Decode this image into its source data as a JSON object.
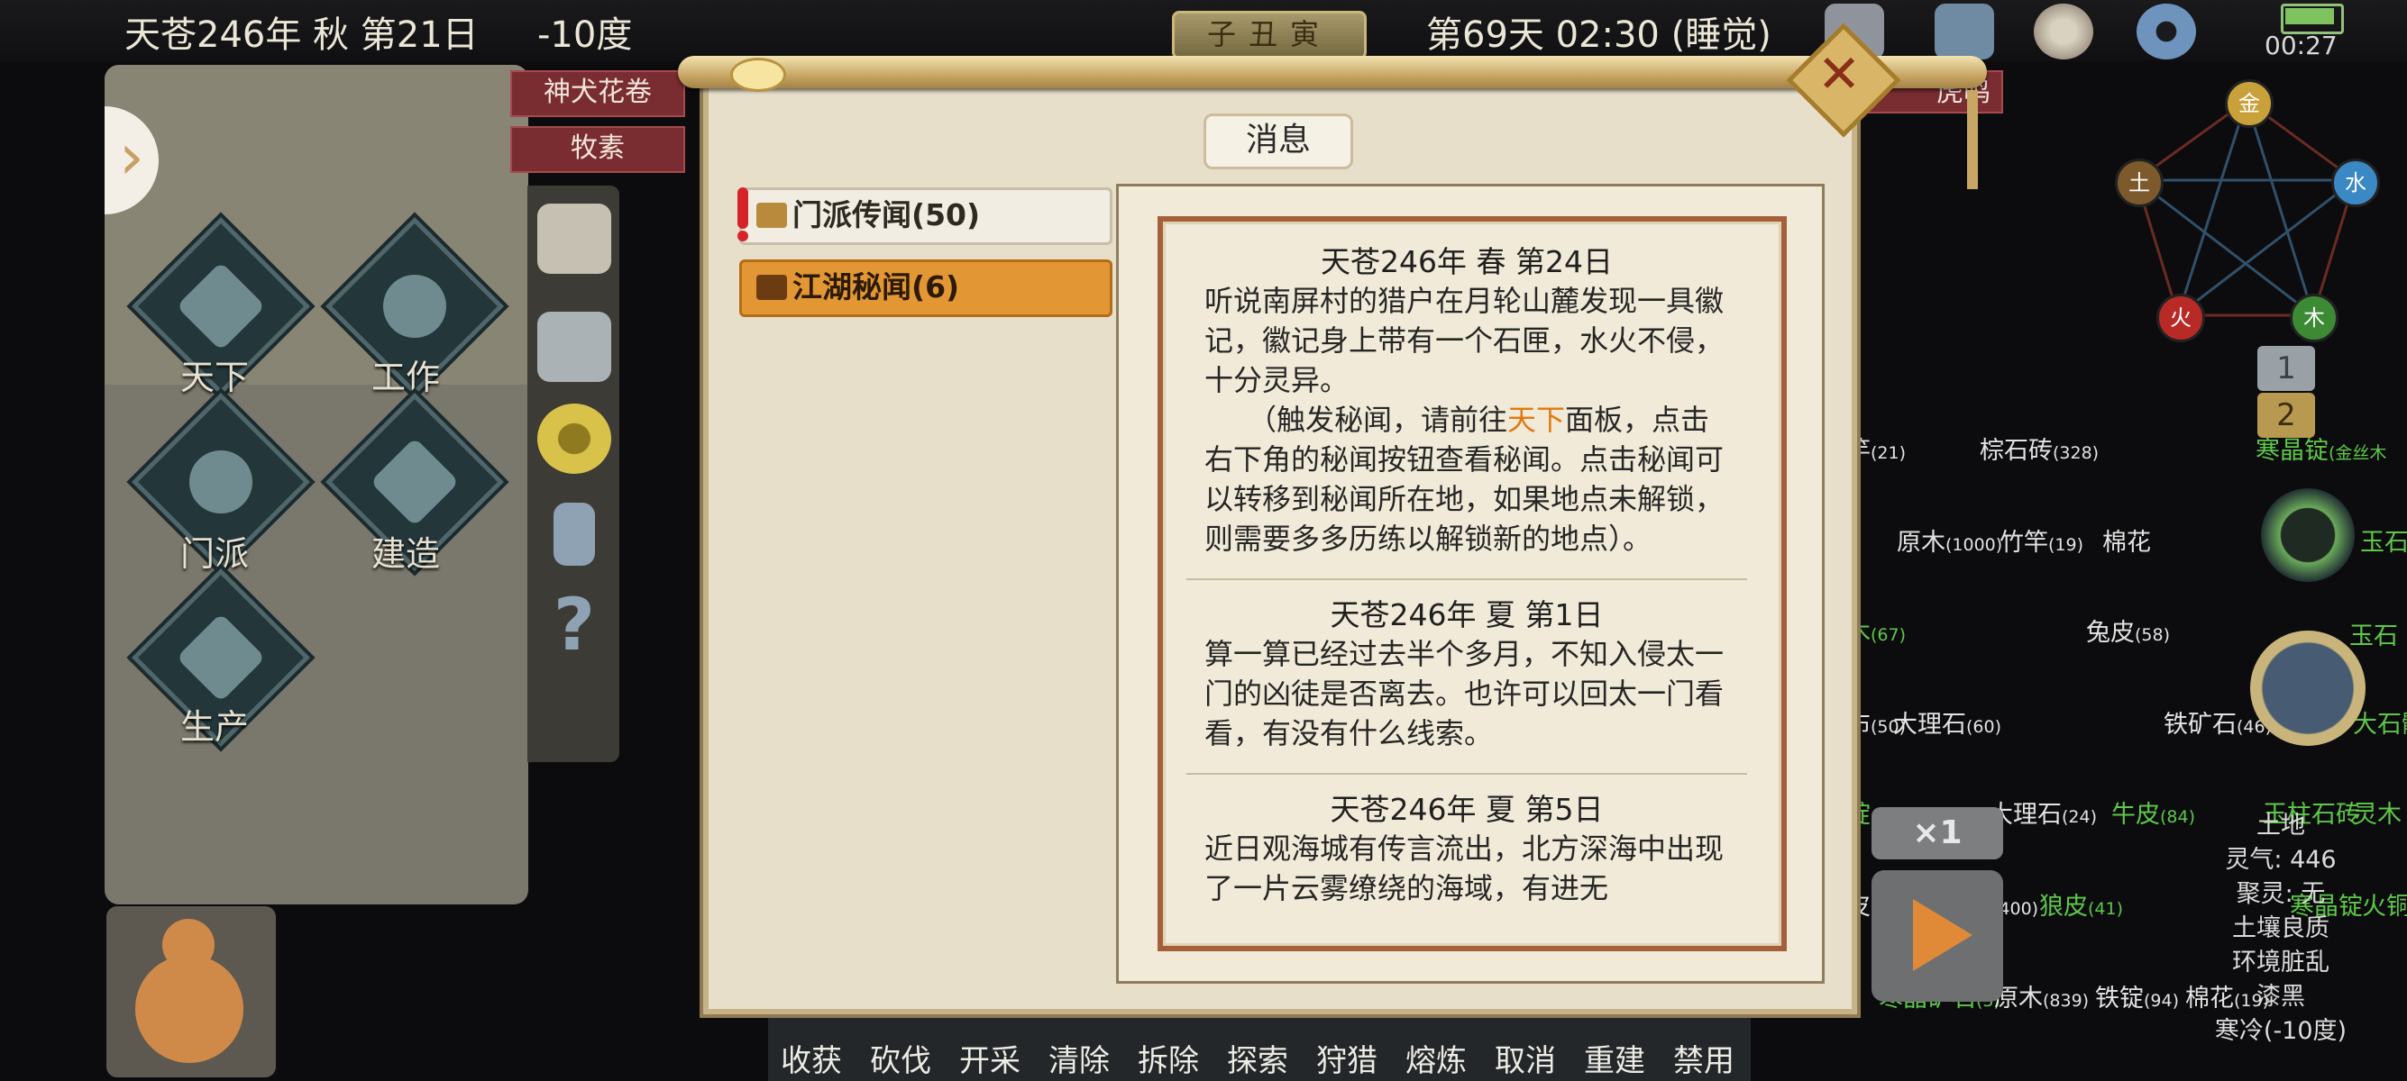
{
  "topbar": {
    "date": "天苍246年 秋 第21日",
    "temperature": "-10度",
    "zodiac": "子丑寅",
    "day_time": "第69天 02:30 (睡觉)",
    "clock": "00:27",
    "colors": {
      "bar": "#101012",
      "zodiac": "#a99a6c"
    }
  },
  "left_menu": {
    "items": [
      {
        "label": "天下",
        "icon": "world-map-icon"
      },
      {
        "label": "工作",
        "icon": "clock-scroll-icon"
      },
      {
        "label": "门派",
        "icon": "sect-cloud-icon"
      },
      {
        "label": "建造",
        "icon": "build-tower-icon"
      },
      {
        "label": "生产",
        "icon": "hammer-tools-icon"
      }
    ]
  },
  "tags": {
    "shenquan": "神犬花卷",
    "musu": "牧素",
    "right_tag": "虎鸣"
  },
  "dialog": {
    "title": "消息",
    "tabs": [
      {
        "label": "门派传闻(50)",
        "selected": true
      },
      {
        "label": "江湖秘闻(6)",
        "selected": false
      }
    ],
    "entries": [
      {
        "date": "天苍246年 春 第24日",
        "text1": "听说南屏村的猎户在月轮山麓发现一具徽记，徽记身上带有一个石匣，水火不侵，十分灵异。",
        "text2_pre": "（触发秘闻，请前往",
        "text2_hl": "天下",
        "text2_post": "面板，点击右下角的秘闻按钮查看秘闻。点击秘闻可以转移到秘闻所在地，如果地点未解锁，则需要多多历练以解锁新的地点）。"
      },
      {
        "date": "天苍246年 夏 第1日",
        "text1": "算一算已经过去半个多月，不知入侵太一门的凶徒是否离去。也许可以回太一门看看，有没有什么线索。"
      },
      {
        "date": "天苍246年 夏 第5日",
        "text1": "近日观海城有传言流出，北方深海中出现了一片云雾缭绕的海域，有进无"
      }
    ],
    "colors": {
      "highlight": "#e07a10",
      "tab_other": "#e39634",
      "border": "#a5603a"
    }
  },
  "bottom_actions": [
    "收获",
    "砍伐",
    "开采",
    "清除",
    "拆除",
    "探索",
    "狩猎",
    "熔炼",
    "取消",
    "重建",
    "禁用"
  ],
  "elements": {
    "gold": "金",
    "water": "水",
    "wood": "木",
    "fire": "火",
    "earth": "土"
  },
  "pages": [
    "1",
    "2"
  ],
  "speed": "×1",
  "resources": [
    {
      "name": "竿",
      "qty": "(21)",
      "green": false,
      "pos": 0
    },
    {
      "name": "棕石砖",
      "qty": "(328)",
      "green": false,
      "pos": 1
    },
    {
      "name": "寒晶锭",
      "qty": "(金丝木",
      "green": true,
      "pos": 2
    },
    {
      "name": "原木",
      "qty": "(1000)",
      "green": false,
      "pos": 3
    },
    {
      "name": "竹竿",
      "qty": "(19)",
      "green": false,
      "pos": 4
    },
    {
      "name": "棉花",
      "qty": "",
      "green": false,
      "pos": 5
    },
    {
      "name": "玉石",
      "qty": "",
      "green": true,
      "pos": 6
    },
    {
      "name": "木",
      "qty": "(67)",
      "green": true,
      "pos": 7
    },
    {
      "name": "兔皮",
      "qty": "(58)",
      "green": false,
      "pos": 8
    },
    {
      "name": "玉石",
      "qty": "",
      "green": true,
      "pos": 9
    },
    {
      "name": "布",
      "qty": "(50)",
      "green": false,
      "pos": 10
    },
    {
      "name": "大理石",
      "qty": "(60)",
      "green": false,
      "pos": 11
    },
    {
      "name": "铁矿石",
      "qty": "(46)",
      "green": false,
      "pos": 12
    },
    {
      "name": "大石髓",
      "qty": "",
      "green": true,
      "pos": 13
    },
    {
      "name": "锭",
      "qty": "",
      "green": true,
      "pos": 14
    },
    {
      "name": "大理石",
      "qty": "(24)",
      "green": false,
      "pos": 15
    },
    {
      "name": "牛皮",
      "qty": "(84)",
      "green": true,
      "pos": 16
    },
    {
      "name": "玉柱石砖",
      "qty": "",
      "green": true,
      "pos": 17
    },
    {
      "name": "灵木",
      "qty": "",
      "green": true,
      "pos": 18
    },
    {
      "name": "皮太理石角料",
      "qty": "(400)",
      "green": false,
      "pos": 19
    },
    {
      "name": "狼皮",
      "qty": "(41)",
      "green": true,
      "pos": 20
    },
    {
      "name": "寒晶锭",
      "qty": "",
      "green": true,
      "pos": 21
    },
    {
      "name": "火铜锭",
      "qty": "",
      "green": true,
      "pos": 22
    },
    {
      "name": "寒晶矿石",
      "qty": "(3)",
      "green": true,
      "pos": 23
    },
    {
      "name": "原木",
      "qty": "(839)",
      "green": false,
      "pos": 24
    },
    {
      "name": "铁锭",
      "qty": "(94)",
      "green": false,
      "pos": 25
    },
    {
      "name": "棉花",
      "qty": "(19)",
      "green": false,
      "pos": 26
    }
  ],
  "tile_info": [
    "土地",
    "灵气: 446",
    "聚灵: 无",
    "土壤良质",
    "环境脏乱",
    "漆黑",
    "寒冷(-10度)"
  ]
}
